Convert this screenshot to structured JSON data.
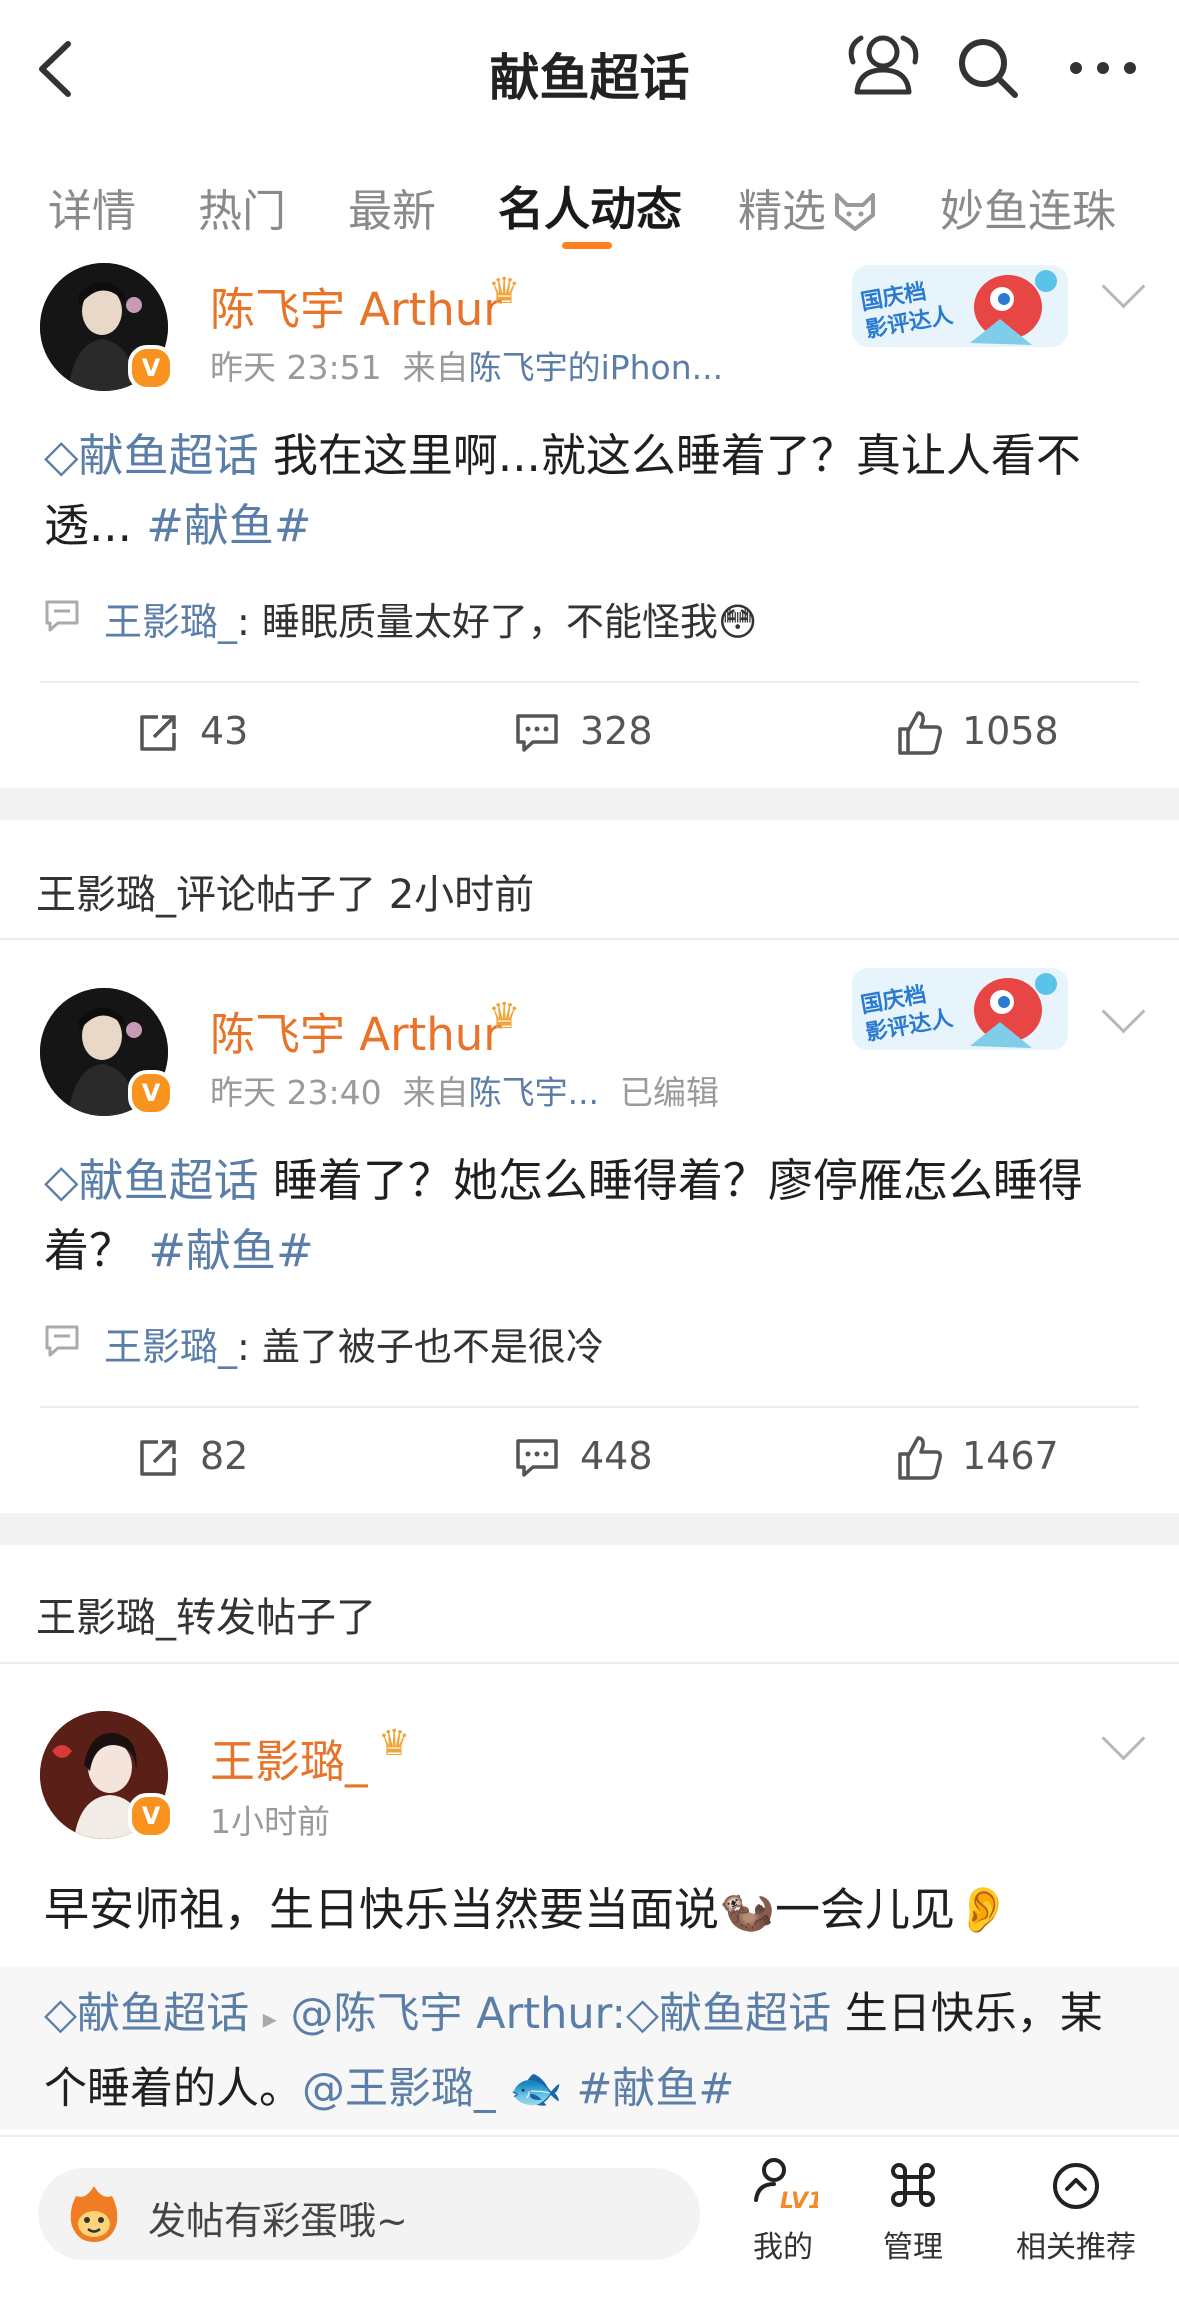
{
  "header": {
    "title": "献鱼超话"
  },
  "tabs": [
    {
      "label": "详情"
    },
    {
      "label": "热门"
    },
    {
      "label": "最新"
    },
    {
      "label": "名人动态",
      "active": true
    },
    {
      "label": "精选"
    },
    {
      "label": "妙鱼连珠"
    }
  ],
  "posts": [
    {
      "username": "陈飞宇 Arthur",
      "time": "昨天 23:51",
      "source_prefix": "来自",
      "source": "陈飞宇的iPhon...",
      "edited": "",
      "topic": "献鱼超话",
      "text": " 我在这里啊...就这么睡着了？真让人看不透... ",
      "hashtag": "#献鱼#",
      "comment_user": "王影璐_",
      "comment_text": ": 睡眠质量太好了，不能怪我",
      "comment_emoji": "😳",
      "reposts": "43",
      "comments": "328",
      "likes": "1058"
    },
    {
      "activity": "王影璐_评论帖子了 2小时前",
      "username": "陈飞宇 Arthur",
      "time": "昨天 23:40",
      "source_prefix": "来自",
      "source": "陈飞宇...",
      "edited": "已编辑",
      "topic": "献鱼超话",
      "text": " 睡着了？她怎么睡得着？廖停雁怎么睡得着？ ",
      "hashtag": "#献鱼#",
      "comment_user": "王影璐_",
      "comment_text": ": 盖了被子也不是很冷",
      "reposts": "82",
      "comments": "448",
      "likes": "1467"
    },
    {
      "activity": "王影璐_转发帖子了",
      "username": "王影璐_",
      "time": "1小时前",
      "text": "早安师祖，生日快乐当然要当面说",
      "emoji1": "🦦",
      "text2": "一会儿见",
      "emoji2": "👂",
      "repost": {
        "topic": "献鱼超话",
        "arrow": "▸",
        "mention": "@陈飞宇 Arthur:",
        "topic2": "献鱼超话",
        "text": " 生日快乐，某个睡着的人。",
        "mention2": "@王影璐_",
        "emoji": "🐟",
        "hashtag": "#献鱼#"
      }
    }
  ],
  "banner": {
    "line1": "国庆档",
    "line2": "影评达人"
  },
  "bottom_bar": {
    "compose_placeholder": "发帖有彩蛋哦~",
    "compose_icon": "fire-mascot-icon",
    "nav": [
      {
        "label": "我的",
        "badge": "LV1",
        "icon": "level-person-icon"
      },
      {
        "label": "管理",
        "icon": "command-icon"
      },
      {
        "label": "相关推荐",
        "icon": "ear-icon"
      }
    ]
  },
  "colors": {
    "accent": "#ff7f1f",
    "username": "#e8742a",
    "link": "#5a7ea8",
    "meta": "#9a9a9a"
  }
}
